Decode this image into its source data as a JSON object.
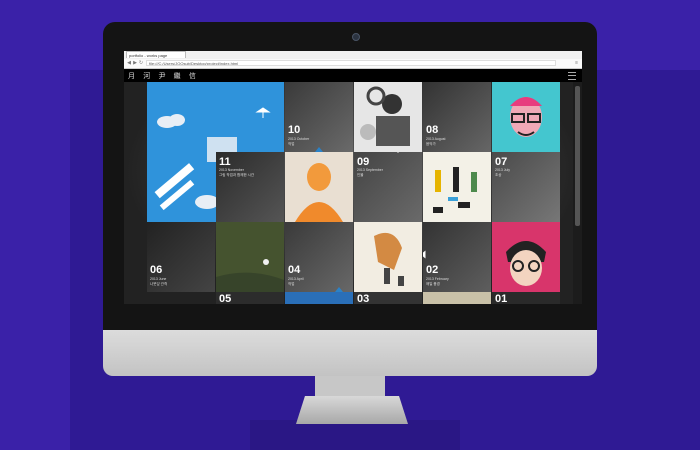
{
  "browser": {
    "tab_title": "portfolio - works page",
    "address": "file:///C:/Users/JOOsub/Desktop/project/index.html"
  },
  "site": {
    "logo": "月 河 尹 繼 信"
  },
  "tiles": [
    {
      "num": "11",
      "date": "2013 November",
      "title": "그림 작업과 함께한 시간"
    },
    {
      "num": "10",
      "date": "2013 October",
      "title": "작업"
    },
    {
      "num": "09",
      "date": "2013 September",
      "title": "인물"
    },
    {
      "num": "08",
      "date": "2013 August",
      "title": "음악가"
    },
    {
      "num": "07",
      "date": "2013 July",
      "title": "초상"
    },
    {
      "num": "06",
      "date": "2013 June",
      "title": "나뭇잎 관객"
    },
    {
      "num": "04",
      "date": "2013 April",
      "title": "작업"
    },
    {
      "num": "02",
      "date": "2013 February",
      "title": "매일 풍경"
    },
    {
      "num": "05",
      "date": "",
      "title": ""
    },
    {
      "num": "03",
      "date": "",
      "title": ""
    },
    {
      "num": "01",
      "date": "",
      "title": ""
    }
  ],
  "colors": {
    "background": "#3a21a8",
    "accent_blue": "#2a82c8",
    "pink": "#d6336a"
  }
}
